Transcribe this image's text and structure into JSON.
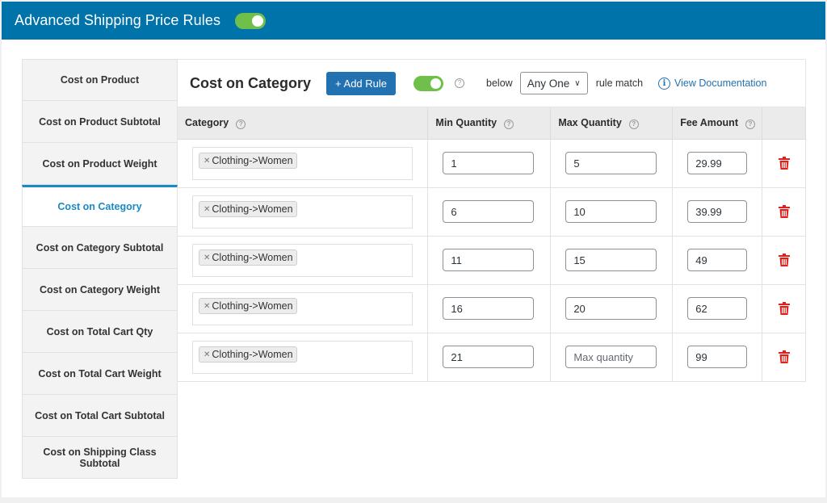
{
  "header": {
    "title": "Advanced Shipping Price Rules",
    "toggle_on": true
  },
  "sidebar": {
    "items": [
      {
        "label": "Cost on Product",
        "active": false
      },
      {
        "label": "Cost on Product Subtotal",
        "active": false
      },
      {
        "label": "Cost on Product Weight",
        "active": false
      },
      {
        "label": "Cost on Category",
        "active": true
      },
      {
        "label": "Cost on Category Subtotal",
        "active": false
      },
      {
        "label": "Cost on Category Weight",
        "active": false
      },
      {
        "label": "Cost on Total Cart Qty",
        "active": false
      },
      {
        "label": "Cost on Total Cart Weight",
        "active": false
      },
      {
        "label": "Cost on Total Cart Subtotal",
        "active": false
      },
      {
        "label": "Cost on Shipping Class Subtotal",
        "active": false
      }
    ]
  },
  "main": {
    "title": "Cost on Category",
    "add_rule_label": "+ Add Rule",
    "toggle_on": true,
    "help_glyph": "?",
    "below_label": "below",
    "match_select": {
      "value": "Any One",
      "chevron": "⌄"
    },
    "rule_match_label": "rule match",
    "doc_link": {
      "icon": "i",
      "label": "View Documentation"
    },
    "columns": [
      "Category",
      "Min Quantity",
      "Max Quantity",
      "Fee Amount"
    ],
    "max_placeholder": "Max quantity",
    "rows": [
      {
        "category": "Clothing->Women",
        "min": "1",
        "max": "5",
        "fee": "29.99"
      },
      {
        "category": "Clothing->Women",
        "min": "6",
        "max": "10",
        "fee": "39.99"
      },
      {
        "category": "Clothing->Women",
        "min": "11",
        "max": "15",
        "fee": "49"
      },
      {
        "category": "Clothing->Women",
        "min": "16",
        "max": "20",
        "fee": "62"
      },
      {
        "category": "Clothing->Women",
        "min": "21",
        "max": "",
        "fee": "99"
      }
    ]
  },
  "colors": {
    "topbar": "#0073aa",
    "toggle": "#6fbf4b",
    "primary_button": "#2271b1",
    "active_tab": "#1a8ac4",
    "delete": "#e0201b"
  }
}
